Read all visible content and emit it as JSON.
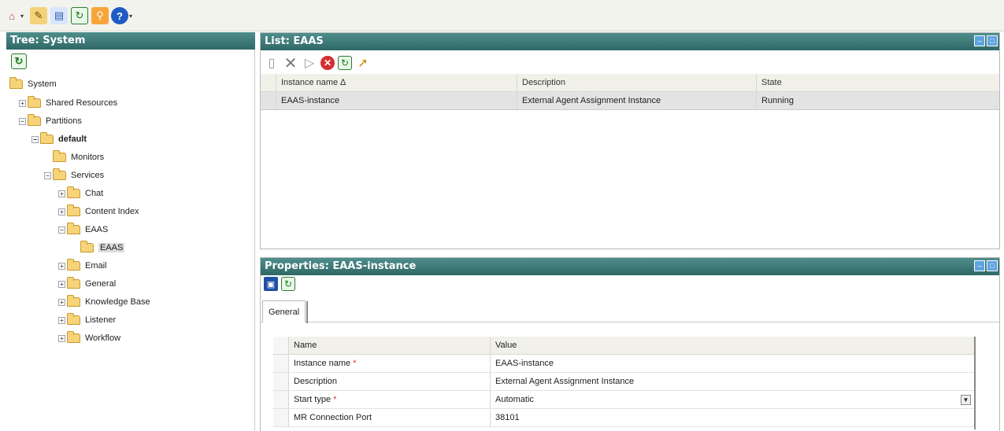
{
  "top_toolbar": {
    "icons": [
      "home-icon",
      "dropdown-caret-icon",
      "edit-icon",
      "book-icon",
      "refresh-icon",
      "tools-icon",
      "help-icon",
      "dropdown-caret-icon"
    ]
  },
  "tree_panel": {
    "title": "Tree: System",
    "nodes": [
      {
        "label": "System",
        "toggle": ""
      },
      {
        "label": "Shared Resources",
        "toggle": "+"
      },
      {
        "label": "Partitions",
        "toggle": "−"
      },
      {
        "label": "default",
        "toggle": "−"
      },
      {
        "label": "Monitors",
        "toggle": ""
      },
      {
        "label": "Services",
        "toggle": "−"
      },
      {
        "label": "Chat",
        "toggle": "+"
      },
      {
        "label": "Content Index",
        "toggle": "+"
      },
      {
        "label": "EAAS",
        "toggle": "−"
      },
      {
        "label": "EAAS",
        "toggle": ""
      },
      {
        "label": "Email",
        "toggle": "+"
      },
      {
        "label": "General",
        "toggle": "+"
      },
      {
        "label": "Knowledge Base",
        "toggle": "+"
      },
      {
        "label": "Listener",
        "toggle": "+"
      },
      {
        "label": "Workflow",
        "toggle": "+"
      }
    ]
  },
  "list_panel": {
    "title": "List: EAAS",
    "columns": [
      "Instance name ∆",
      "Description",
      "State"
    ],
    "rows": [
      [
        "EAAS-instance",
        "External Agent Assignment Instance",
        "Running"
      ]
    ]
  },
  "properties_panel": {
    "title": "Properties: EAAS-instance",
    "tab": "General",
    "columns": [
      "Name",
      "Value"
    ],
    "rows": [
      {
        "name": "Instance name",
        "value": "EAAS-instance",
        "required": "*"
      },
      {
        "name": "Description",
        "value": "External Agent Assignment Instance",
        "required": ""
      },
      {
        "name": "Start type",
        "value": "Automatic",
        "required": "*"
      },
      {
        "name": "MR Connection Port",
        "value": "38101",
        "required": ""
      }
    ]
  },
  "colors": {
    "title_bar": "#3f7c7a",
    "required_star": "#e23030",
    "selected_row": "#e3e3e3"
  }
}
